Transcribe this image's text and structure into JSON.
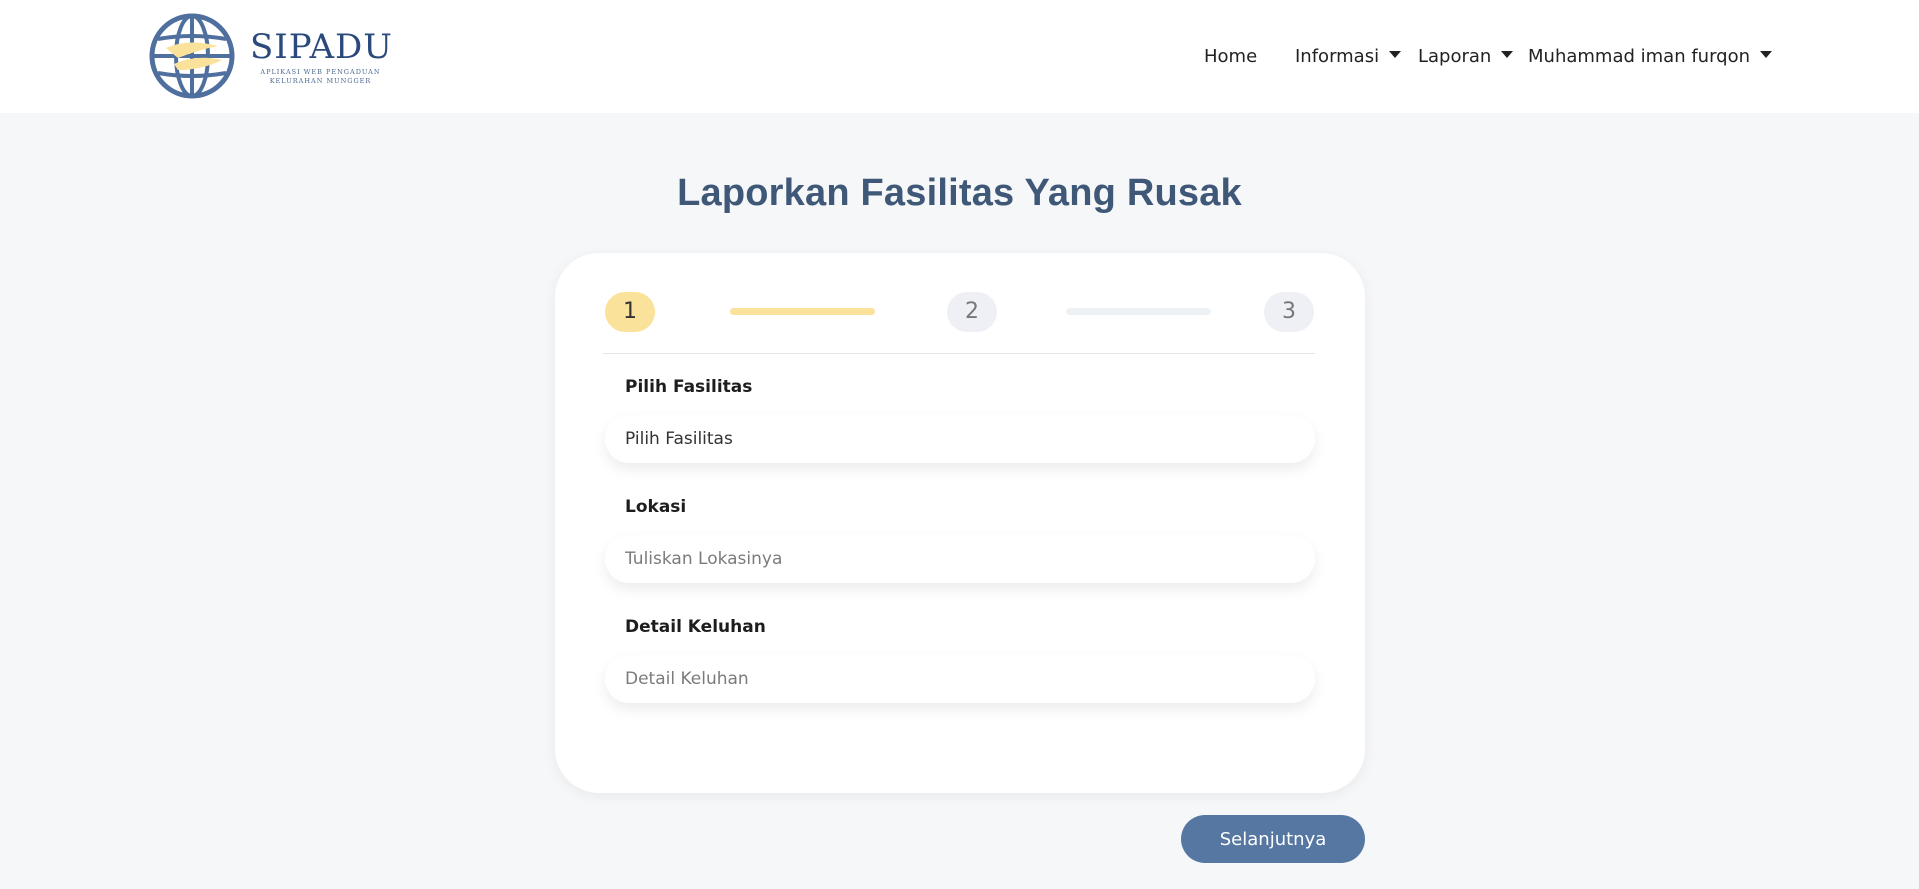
{
  "brand": {
    "name": "SIPADU",
    "tagline": "APLIKASI WEB PENGADUAN KELURAHAN MUNGGER"
  },
  "nav": {
    "home": "Home",
    "informasi": "Informasi",
    "laporan": "Laporan",
    "user": "Muhammad iman furqon"
  },
  "page": {
    "title": "Laporkan Fasilitas Yang Rusak"
  },
  "steps": {
    "current": 1,
    "items": [
      "1",
      "2",
      "3"
    ]
  },
  "form": {
    "fasilitas": {
      "label": "Pilih Fasilitas",
      "value": "Pilih Fasilitas"
    },
    "lokasi": {
      "label": "Lokasi",
      "placeholder": "Tuliskan Lokasinya",
      "value": ""
    },
    "keluhan": {
      "label": "Detail Keluhan",
      "placeholder": "Detail Keluhan",
      "value": ""
    }
  },
  "actions": {
    "next": "Selanjutnya"
  },
  "colors": {
    "accent": "#5677a2",
    "title": "#3f5878",
    "step_active": "#fbe29a",
    "step_inactive": "#eef0f5",
    "background": "#f6f7f9"
  },
  "icons": {
    "logo": "globe-logo-icon",
    "dropdown": "caret-down-icon"
  }
}
